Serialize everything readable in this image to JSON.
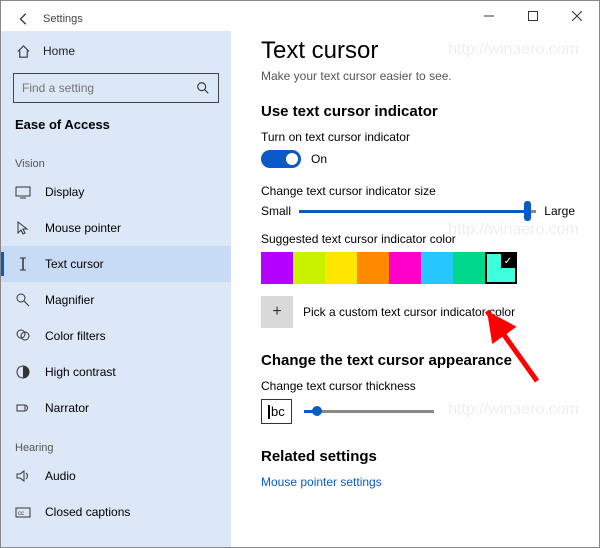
{
  "window": {
    "title": "Settings",
    "home_label": "Home",
    "search_placeholder": "Find a setting",
    "heading": "Ease of Access"
  },
  "sidebar": {
    "groups": {
      "vision": "Vision",
      "hearing": "Hearing"
    },
    "items": {
      "display": "Display",
      "mouse_pointer": "Mouse pointer",
      "text_cursor": "Text cursor",
      "magnifier": "Magnifier",
      "color_filters": "Color filters",
      "high_contrast": "High contrast",
      "narrator": "Narrator",
      "audio": "Audio",
      "closed_captions": "Closed captions"
    }
  },
  "main": {
    "title": "Text cursor",
    "subtitle": "Make your text cursor easier to see.",
    "use_indicator": "Use text cursor indicator",
    "toggle_label": "Turn on text cursor indicator",
    "toggle_state": "On",
    "size_label": "Change text cursor indicator size",
    "size_small": "Small",
    "size_large": "Large",
    "color_label": "Suggested text cursor indicator color",
    "custom_label": "Pick a custom text cursor indicator color",
    "appearance": "Change the text cursor appearance",
    "thickness_label": "Change text cursor thickness",
    "thickness_sample": "bc",
    "related": "Related settings",
    "related_link": "Mouse pointer settings"
  },
  "colors": [
    "#b400ff",
    "#c8f200",
    "#ffe600",
    "#ff8a00",
    "#ff00c8",
    "#26c6ff",
    "#00d98a",
    "#40ffdc"
  ],
  "selected_color_index": 7,
  "watermark": "http://winaero.com"
}
